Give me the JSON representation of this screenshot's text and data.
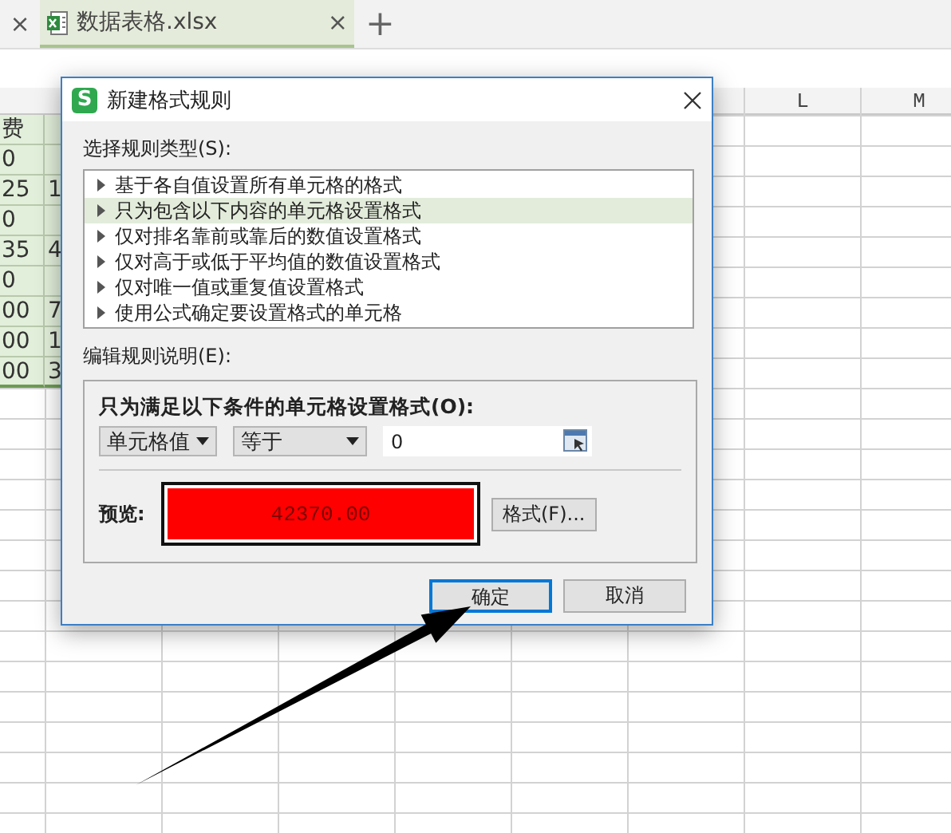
{
  "tab_bar": {
    "leading_close": "×",
    "tabs": [
      {
        "label": "数据表格.xlsx",
        "selected": true,
        "close": "×"
      }
    ],
    "new_tab": "+"
  },
  "sheet": {
    "column_headers": [
      {
        "label": "L"
      },
      {
        "label": "M"
      }
    ],
    "rows": [
      {
        "column_1": "费"
      },
      {
        "column_1": "0"
      },
      {
        "column_1": "25",
        "column_2": "1"
      },
      {
        "column_1": "0"
      },
      {
        "column_1": "35",
        "column_2": "4"
      },
      {
        "column_1": "0"
      },
      {
        "column_1": "00",
        "column_2": "7"
      },
      {
        "column_1": "00",
        "column_2": "1"
      },
      {
        "column_1": "00",
        "column_2": "3"
      }
    ]
  },
  "dialog": {
    "logo_text": "S",
    "title": "新建格式规则",
    "rule_type_label": "选择规则类型(S):",
    "rule_types": [
      {
        "label": "基于各自值设置所有单元格的格式",
        "selected": false
      },
      {
        "label": "只为包含以下内容的单元格设置格式",
        "selected": true
      },
      {
        "label": "仅对排名靠前或靠后的数值设置格式",
        "selected": false
      },
      {
        "label": "仅对高于或低于平均值的数值设置格式",
        "selected": false
      },
      {
        "label": "仅对唯一值或重复值设置格式",
        "selected": false
      },
      {
        "label": "使用公式确定要设置格式的单元格",
        "selected": false
      }
    ],
    "description_label": "编辑规则说明(E):",
    "condition": {
      "heading": "只为满足以下条件的单元格设置格式(O):",
      "dropdowns": [
        {
          "value": "单元格值"
        },
        {
          "value": "等于"
        }
      ],
      "value": "0"
    },
    "preview": {
      "label": "预览:",
      "sample": "42370.00",
      "format_button": "格式(F)..."
    },
    "buttons": [
      {
        "label": "确定",
        "default": true
      },
      {
        "label": "取消",
        "default": false
      }
    ]
  }
}
